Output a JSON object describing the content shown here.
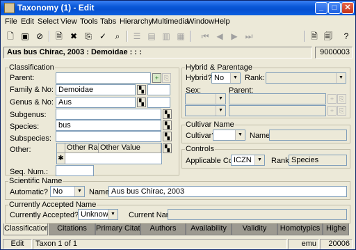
{
  "window": {
    "title": "Taxonomy (1) - Edit",
    "minimize": "_",
    "maximize": "□",
    "close": "✕"
  },
  "menu": [
    "File",
    "Edit",
    "Select",
    "View",
    "Tools",
    "Tabs",
    "Hierarchy",
    "Multimedia",
    "Window",
    "Help"
  ],
  "record": {
    "name": "Aus bus Chirac, 2003 : Demoidae : : :",
    "id": "9000003"
  },
  "classification": {
    "legend": "Classification",
    "parent_label": "Parent:",
    "parent_value": "",
    "family_label": "Family & No:",
    "family_value": "Demoidae",
    "genus_label": "Genus & No:",
    "genus_value": "Aus",
    "subgenus_label": "Subgenus:",
    "subgenus_value": "",
    "species_label": "Species:",
    "species_value": "bus",
    "subspecies_label": "Subspecies:",
    "subspecies_value": "",
    "other_label": "Other:",
    "other_col1": "Other Rank",
    "other_col2": "Other Value",
    "new_row_marker": "✱",
    "seqnum_label": "Seq. Num.:",
    "seqnum_value": ""
  },
  "hybrid": {
    "legend": "Hybrid & Parentage",
    "hybrid_label": "Hybrid?",
    "hybrid_value": "No",
    "rank_label": "Rank:",
    "rank_value": "",
    "sex_label": "Sex:",
    "parent_label": "Parent:"
  },
  "cultivar": {
    "legend": "Cultivar Name",
    "cultivar_label": "Cultivar?",
    "cultivar_value": "",
    "name_label": "Name:",
    "name_value": ""
  },
  "controls": {
    "legend": "Controls",
    "code_label": "Applicable Code:",
    "code_value": "ICZN",
    "rank_label": "Rank:",
    "rank_value": "Species"
  },
  "scientific": {
    "legend": "Scientific Name",
    "automatic_label": "Automatic?",
    "automatic_value": "No",
    "name_label": "Name:",
    "name_value": "Aus bus Chirac, 2003"
  },
  "accepted": {
    "legend": "Currently Accepted Name",
    "accepted_label": "Currently Accepted?",
    "accepted_value": "Unknown",
    "current_label": "Current Name:",
    "current_value": ""
  },
  "tabs": [
    "Classification",
    "Citations",
    "Primary Citation",
    "Authors",
    "Availability",
    "Validity",
    "Homotypics",
    "Highe"
  ],
  "status": {
    "mode": "Edit",
    "record": "Taxon 1 of 1",
    "user": "emu",
    "number": "20006"
  }
}
